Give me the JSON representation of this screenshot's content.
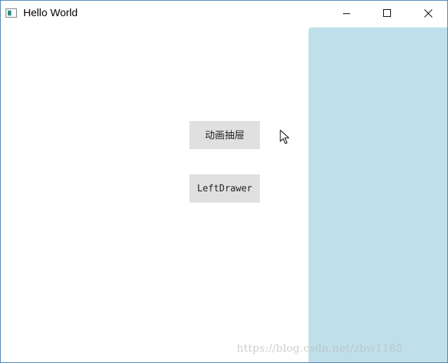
{
  "window": {
    "title": "Hello World",
    "controls": {
      "minimize_icon": "minimize-icon",
      "maximize_icon": "maximize-icon",
      "close_icon": "close-icon"
    }
  },
  "main": {
    "animate_drawer_button_label": "动画抽屉",
    "left_drawer_button_label": "LeftDrawer"
  },
  "drawer": {
    "color": "#bfe0ea"
  },
  "watermark": "https://blog.csdn.net/zbw1185"
}
